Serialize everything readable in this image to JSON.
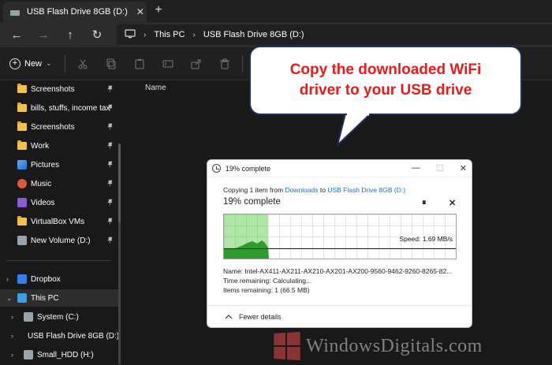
{
  "tab": {
    "title": "USB Flash Drive 8GB (D:)",
    "close": "✕",
    "new_tab": "+"
  },
  "nav": {
    "back": "←",
    "forward": "→",
    "up": "↑",
    "refresh": "↻"
  },
  "address": {
    "segments": [
      "This PC",
      "USB Flash Drive 8GB (D:)"
    ],
    "separator": "›"
  },
  "toolbar": {
    "new_label": "New",
    "new_caret": "⌄"
  },
  "sidebar": {
    "quick_access": [
      {
        "label": "Screenshots",
        "pinned": true
      },
      {
        "label": "bills, stuffs, income tax",
        "pinned": true
      },
      {
        "label": "Screenshots",
        "pinned": true
      },
      {
        "label": "Work",
        "pinned": true
      },
      {
        "label": "Pictures",
        "pinned": true
      },
      {
        "label": "Music",
        "pinned": true
      },
      {
        "label": "Videos",
        "pinned": true
      },
      {
        "label": "VirtualBox VMs",
        "pinned": true
      },
      {
        "label": "New Volume (D:)",
        "pinned": true
      }
    ],
    "tree": [
      {
        "label": "Dropbox"
      },
      {
        "label": "This PC",
        "selected": true
      },
      {
        "label": "System (C:)"
      },
      {
        "label": "USB Flash Drive 8GB (D:)"
      },
      {
        "label": "Small_HDD (H:)"
      }
    ],
    "pin_glyph": "📌"
  },
  "content": {
    "column_name": "Name"
  },
  "callout": {
    "line1": "Copy the downloaded WiFi",
    "line2": "driver to your USB drive",
    "text_color": "#e81b1b",
    "border_color": "#1f2d59"
  },
  "dialog": {
    "title": "19% complete",
    "copy_prefix": "Copying 1 item from",
    "copy_from": "Downloads",
    "copy_to_word": "to",
    "copy_to": "USB Flash Drive 8GB (D:)",
    "percent_text": "19% complete",
    "progress": 0.19,
    "speed": "Speed: 1.69 MB/s",
    "name_line": "Name:  Intel-AX411-AX211-AX210-AX201-AX200-9560-9462-9260-8265-82...",
    "time_line": "Time remaining:  Calculating...",
    "items_line": "Items remaining:  1 (66.5 MB)",
    "fewer_details": "Fewer details",
    "pause": "⏸",
    "cancel": "✕",
    "minimize": "—",
    "maximize": "☐",
    "close": "✕"
  },
  "watermark": {
    "text": "WindowsDigitals.com"
  }
}
